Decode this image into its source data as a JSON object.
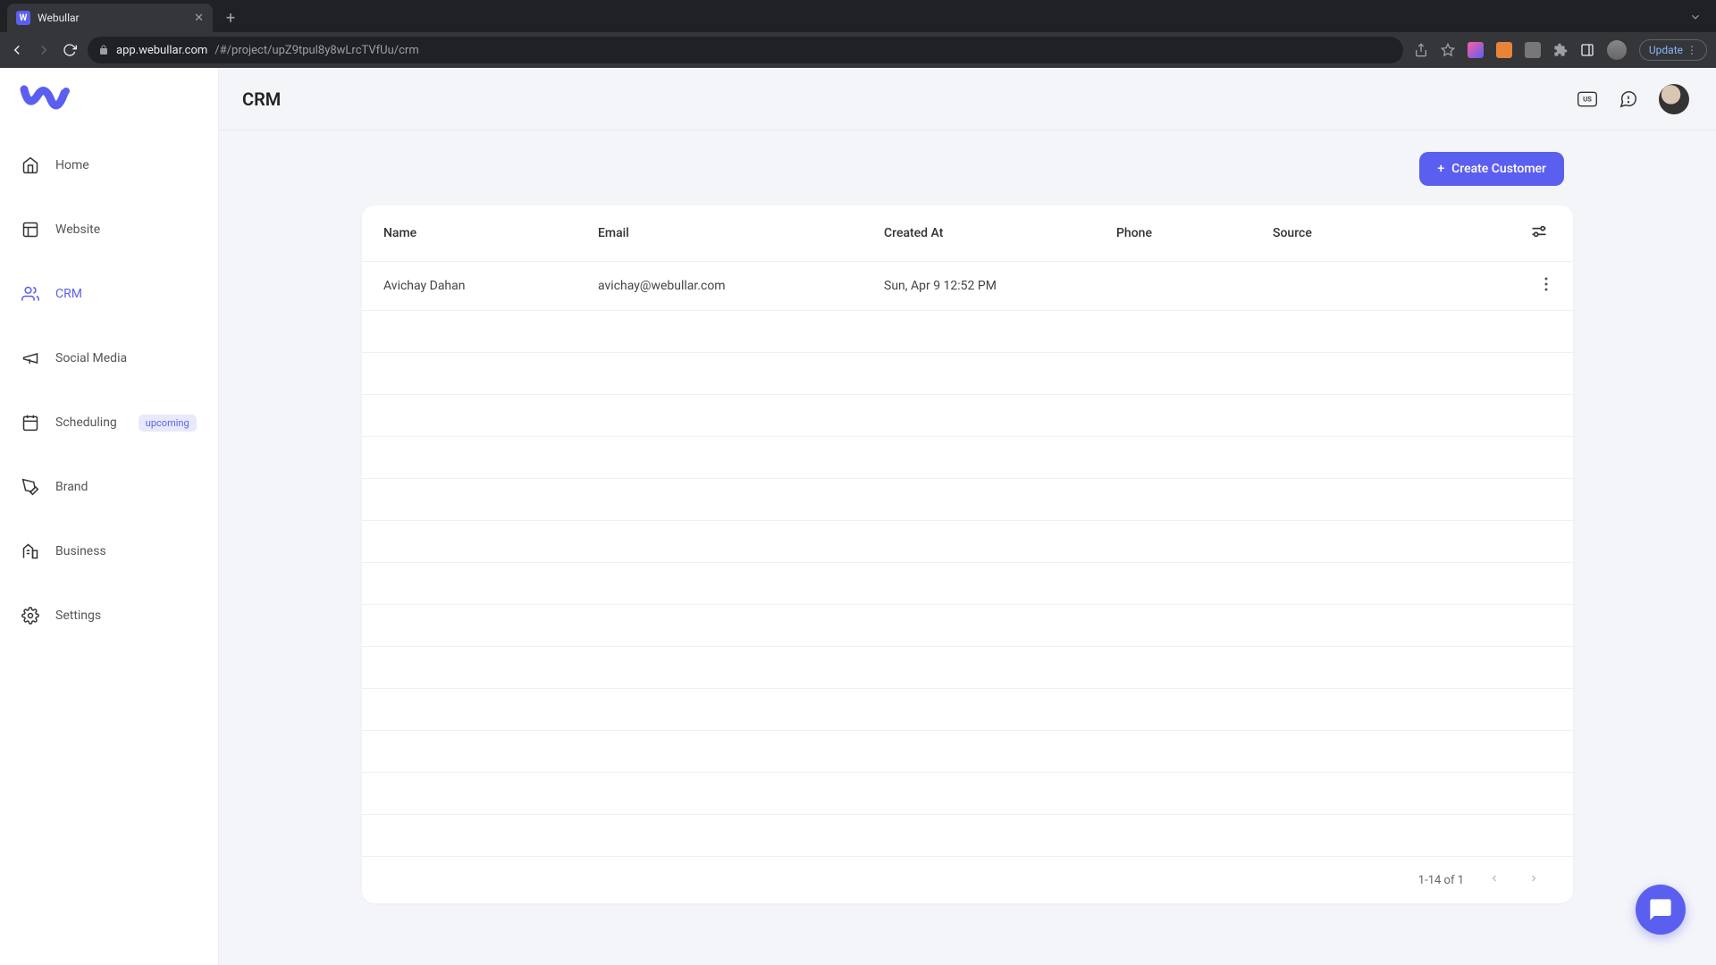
{
  "browser": {
    "tab_title": "Webullar",
    "url_host": "app.webullar.com",
    "url_path": "/#/project/upZ9tpul8y8wLrcTVfUu/crm",
    "update_label": "Update"
  },
  "sidebar": {
    "items": [
      {
        "label": "Home",
        "active": false
      },
      {
        "label": "Website",
        "active": false
      },
      {
        "label": "CRM",
        "active": true
      },
      {
        "label": "Social Media",
        "active": false
      },
      {
        "label": "Scheduling",
        "active": false,
        "badge": "upcoming"
      },
      {
        "label": "Brand",
        "active": false
      },
      {
        "label": "Business",
        "active": false
      },
      {
        "label": "Settings",
        "active": false
      }
    ]
  },
  "header": {
    "title": "CRM",
    "lang_badge": "US"
  },
  "toolbar": {
    "create_label": "Create Customer"
  },
  "table": {
    "columns": {
      "name": "Name",
      "email": "Email",
      "created": "Created At",
      "phone": "Phone",
      "source": "Source"
    },
    "rows": [
      {
        "name": "Avichay Dahan",
        "email": "avichay@webullar.com",
        "created": "Sun, Apr 9 12:52 PM",
        "phone": "",
        "source": ""
      }
    ],
    "empty_rows": 13,
    "pagination": "1-14 of 1"
  }
}
